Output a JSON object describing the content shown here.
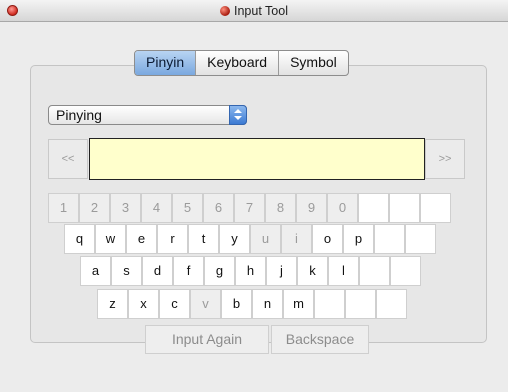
{
  "window": {
    "title": "Input Tool",
    "icon": "app-icon"
  },
  "tabs": [
    {
      "label": "Pinyin",
      "active": true
    },
    {
      "label": "Keyboard",
      "active": false
    },
    {
      "label": "Symbol",
      "active": false
    }
  ],
  "method_select": {
    "value": "Pinying"
  },
  "nav": {
    "prev": "<<",
    "next": ">>"
  },
  "composition": {
    "value": ""
  },
  "keyboard": {
    "row0": [
      {
        "label": "1",
        "on": false
      },
      {
        "label": "2",
        "on": false
      },
      {
        "label": "3",
        "on": false
      },
      {
        "label": "4",
        "on": false
      },
      {
        "label": "5",
        "on": false
      },
      {
        "label": "6",
        "on": false
      },
      {
        "label": "7",
        "on": false
      },
      {
        "label": "8",
        "on": false
      },
      {
        "label": "9",
        "on": false
      },
      {
        "label": "0",
        "on": false
      },
      {
        "label": "",
        "on": true
      },
      {
        "label": "",
        "on": true
      },
      {
        "label": "",
        "on": true
      }
    ],
    "row1": [
      {
        "label": "q",
        "on": true
      },
      {
        "label": "w",
        "on": true
      },
      {
        "label": "e",
        "on": true
      },
      {
        "label": "r",
        "on": true
      },
      {
        "label": "t",
        "on": true
      },
      {
        "label": "y",
        "on": true
      },
      {
        "label": "u",
        "on": false
      },
      {
        "label": "i",
        "on": false
      },
      {
        "label": "o",
        "on": true
      },
      {
        "label": "p",
        "on": true
      },
      {
        "label": "",
        "on": true
      },
      {
        "label": "",
        "on": true
      }
    ],
    "row2": [
      {
        "label": "a",
        "on": true
      },
      {
        "label": "s",
        "on": true
      },
      {
        "label": "d",
        "on": true
      },
      {
        "label": "f",
        "on": true
      },
      {
        "label": "g",
        "on": true
      },
      {
        "label": "h",
        "on": true
      },
      {
        "label": "j",
        "on": true
      },
      {
        "label": "k",
        "on": true
      },
      {
        "label": "l",
        "on": true
      },
      {
        "label": "",
        "on": true
      },
      {
        "label": "",
        "on": true
      }
    ],
    "row3": [
      {
        "label": "z",
        "on": true
      },
      {
        "label": "x",
        "on": true
      },
      {
        "label": "c",
        "on": true
      },
      {
        "label": "v",
        "on": false
      },
      {
        "label": "b",
        "on": true
      },
      {
        "label": "n",
        "on": true
      },
      {
        "label": "m",
        "on": true
      },
      {
        "label": "",
        "on": true
      },
      {
        "label": "",
        "on": true
      },
      {
        "label": "",
        "on": true
      }
    ]
  },
  "actions": {
    "input_again": "Input Again",
    "backspace": "Backspace"
  }
}
